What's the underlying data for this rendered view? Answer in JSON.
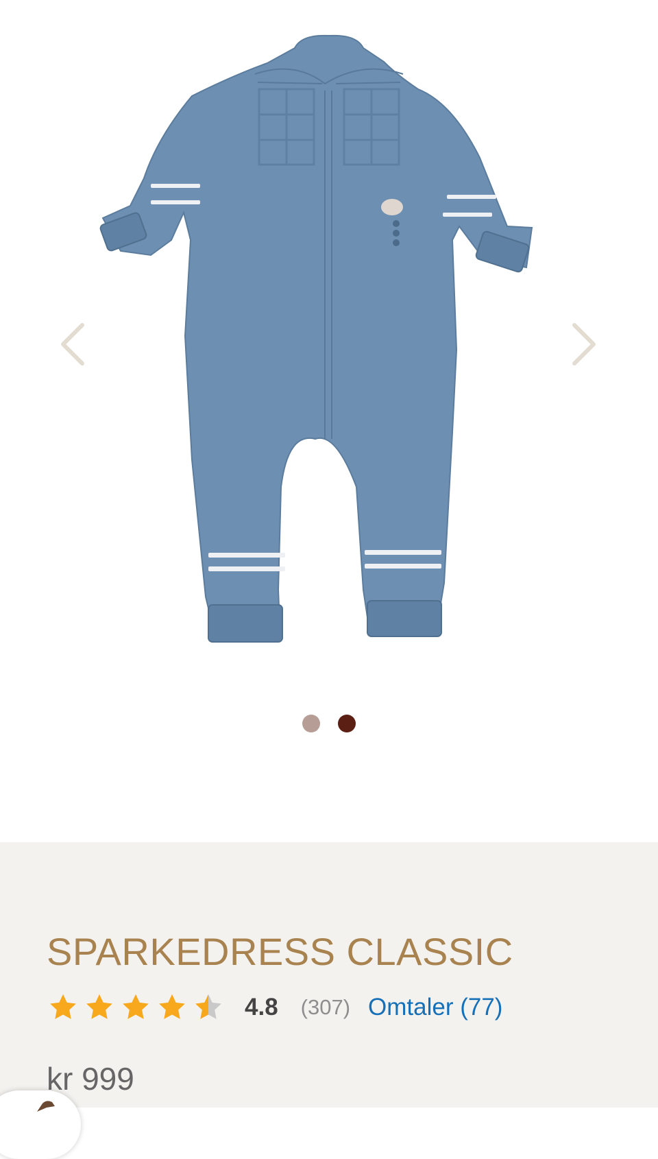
{
  "product": {
    "title": "SPARKEDRESS CLASSIC",
    "rating": 4.8,
    "rating_display": "4.8",
    "rating_count": "(307)",
    "reviews_link": "Omtaler (77)",
    "price": "kr 999"
  },
  "gallery": {
    "image_subject": "blue-knitted-baby-overall",
    "prev_icon": "chevron-left-icon",
    "next_icon": "chevron-right-icon",
    "colors": {
      "garment": "#6d8fb1",
      "arrow": "#e3ddd1"
    },
    "swatches": [
      {
        "color": "#b69d95",
        "selected": false
      },
      {
        "color": "#5c1f14",
        "selected": true
      }
    ]
  },
  "colors": {
    "accent_title": "#a8834f",
    "star": "#f8a81c",
    "link": "#1570b8",
    "info_bg": "#f4f2ef"
  }
}
